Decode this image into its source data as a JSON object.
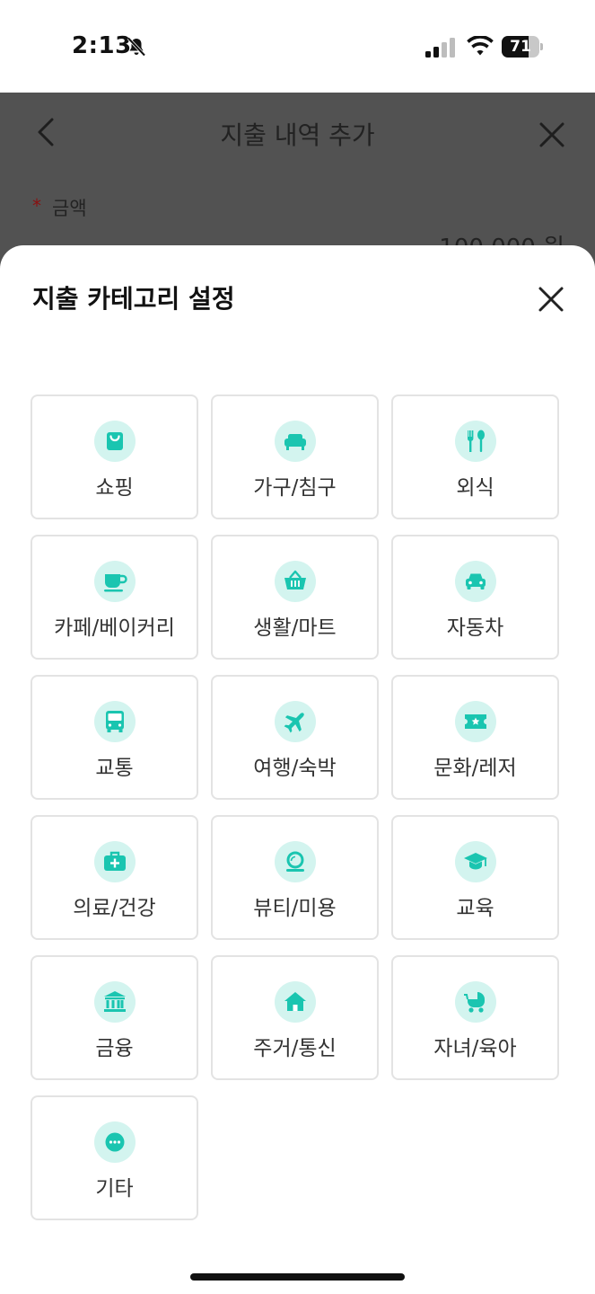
{
  "status_bar": {
    "time": "2:13",
    "battery": "71",
    "battery_level": 0.71
  },
  "background_page": {
    "title": "지출 내역 추가",
    "required_mark": "*",
    "amount_label": "금액",
    "amount_value": "100,000 원"
  },
  "sheet": {
    "title": "지출 카테고리 설정"
  },
  "categories": [
    {
      "label": "쇼핑",
      "icon": "shopping-bag-icon"
    },
    {
      "label": "가구/침구",
      "icon": "sofa-icon"
    },
    {
      "label": "외식",
      "icon": "fork-spoon-icon"
    },
    {
      "label": "카페/베이커리",
      "icon": "coffee-cup-icon"
    },
    {
      "label": "생활/마트",
      "icon": "basket-icon"
    },
    {
      "label": "자동차",
      "icon": "car-icon"
    },
    {
      "label": "교통",
      "icon": "bus-icon"
    },
    {
      "label": "여행/숙박",
      "icon": "airplane-icon"
    },
    {
      "label": "문화/레저",
      "icon": "ticket-icon"
    },
    {
      "label": "의료/건강",
      "icon": "medical-kit-icon"
    },
    {
      "label": "뷰티/미용",
      "icon": "mirror-icon"
    },
    {
      "label": "교육",
      "icon": "graduation-cap-icon"
    },
    {
      "label": "금융",
      "icon": "bank-icon"
    },
    {
      "label": "주거/통신",
      "icon": "house-icon"
    },
    {
      "label": "자녀/육아",
      "icon": "stroller-icon"
    },
    {
      "label": "기타",
      "icon": "more-dots-icon"
    }
  ],
  "colors": {
    "accent": "#1ac5b0",
    "icon_bg": "#d3f4ef",
    "overlay": "#525252"
  }
}
